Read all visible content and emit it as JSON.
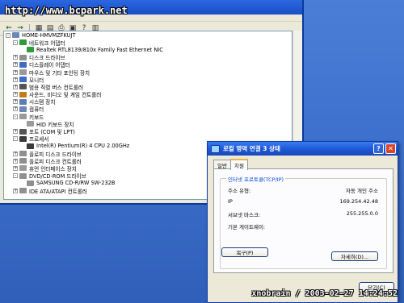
{
  "watermark": "http://www.bcpark.net",
  "signature": "xnobrain / 2003-02-27 14:24:52",
  "device_manager": {
    "items": [
      {
        "label": "HOME-HMVMZFKUJT",
        "exp": "-",
        "icon": "computer-icon",
        "color": "#6b87b8",
        "indent": 0
      },
      {
        "label": "네트워크 어댑터",
        "exp": "-",
        "icon": "network-adapter-icon",
        "color": "#2f9b3a",
        "indent": 1
      },
      {
        "label": "Realtek RTL8139/810x Family Fast Ethernet NIC",
        "exp": "",
        "icon": "network-card-icon",
        "color": "#2f9b3a",
        "indent": 2
      },
      {
        "label": "디스크 드라이브",
        "exp": "+",
        "icon": "disk-drive-icon",
        "color": "#8f8f8f",
        "indent": 1
      },
      {
        "label": "디스플레이 어댑터",
        "exp": "+",
        "icon": "display-adapter-icon",
        "color": "#3d6dc7",
        "indent": 1
      },
      {
        "label": "마우스 및 기타 포인팅 장치",
        "exp": "+",
        "icon": "mouse-icon",
        "color": "#9a9a9a",
        "indent": 1
      },
      {
        "label": "모니터",
        "exp": "+",
        "icon": "monitor-icon",
        "color": "#3d6dc7",
        "indent": 1
      },
      {
        "label": "범용 직렬 버스 컨트롤러",
        "exp": "+",
        "icon": "usb-icon",
        "color": "#555555",
        "indent": 1
      },
      {
        "label": "사운드, 비디오 및 게임 컨트롤러",
        "exp": "+",
        "icon": "sound-icon",
        "color": "#c27a1a",
        "indent": 1
      },
      {
        "label": "시스템 장치",
        "exp": "+",
        "icon": "system-device-icon",
        "color": "#5a7cb8",
        "indent": 1
      },
      {
        "label": "컴퓨터",
        "exp": "+",
        "icon": "computer-icon",
        "color": "#6b87b8",
        "indent": 1
      },
      {
        "label": "키보드",
        "exp": "-",
        "icon": "keyboard-icon",
        "color": "#9a9a9a",
        "indent": 1
      },
      {
        "label": "HID 키보드 장치",
        "exp": "",
        "icon": "keyboard-icon",
        "color": "#9a9a9a",
        "indent": 2
      },
      {
        "label": "포트 (COM 및 LPT)",
        "exp": "+",
        "icon": "port-icon",
        "color": "#555555",
        "indent": 1
      },
      {
        "label": "프로세서",
        "exp": "-",
        "icon": "processor-icon",
        "color": "#3a3a3a",
        "indent": 1
      },
      {
        "label": "Intel(R) Pentium(R) 4 CPU 2.00GHz",
        "exp": "",
        "icon": "processor-icon",
        "color": "#3a3a3a",
        "indent": 2
      },
      {
        "label": "플로피 디스크 드라이브",
        "exp": "+",
        "icon": "floppy-icon",
        "color": "#8f8f8f",
        "indent": 1
      },
      {
        "label": "플로피 디스크 컨트롤러",
        "exp": "+",
        "icon": "floppy-controller-icon",
        "color": "#8f8f8f",
        "indent": 1
      },
      {
        "label": "휴먼 인터페이스 장치",
        "exp": "+",
        "icon": "hid-icon",
        "color": "#9a9a9a",
        "indent": 1
      },
      {
        "label": "DVD/CD-ROM 드라이브",
        "exp": "-",
        "icon": "cdrom-icon",
        "color": "#8f8f8f",
        "indent": 1
      },
      {
        "label": "SAMSUNG CD-R/RW SW-232B",
        "exp": "",
        "icon": "cdrom-icon",
        "color": "#8f8f8f",
        "indent": 2
      },
      {
        "label": "IDE ATA/ATAPI 컨트롤러",
        "exp": "+",
        "icon": "ide-icon",
        "color": "#8f8f8f",
        "indent": 1
      }
    ]
  },
  "dialog": {
    "title": "로컬 영역 연결 3 상태",
    "tabs": [
      "일반",
      "지원"
    ],
    "group_label": "인터넷 프로토콜(TCP/IP)",
    "rows": [
      {
        "k": "주소 유형:",
        "v": "자동 개인 주소"
      },
      {
        "k": "IP",
        "v": "169.254.42.48"
      },
      {
        "k": "서브넷 마스크:",
        "v": "255.255.0.0"
      },
      {
        "k": "기본 게이트웨이:",
        "v": ""
      }
    ],
    "details_button": "자세히(D)...",
    "repair_button": "복구(P)",
    "close_button": "닫기(C)"
  }
}
